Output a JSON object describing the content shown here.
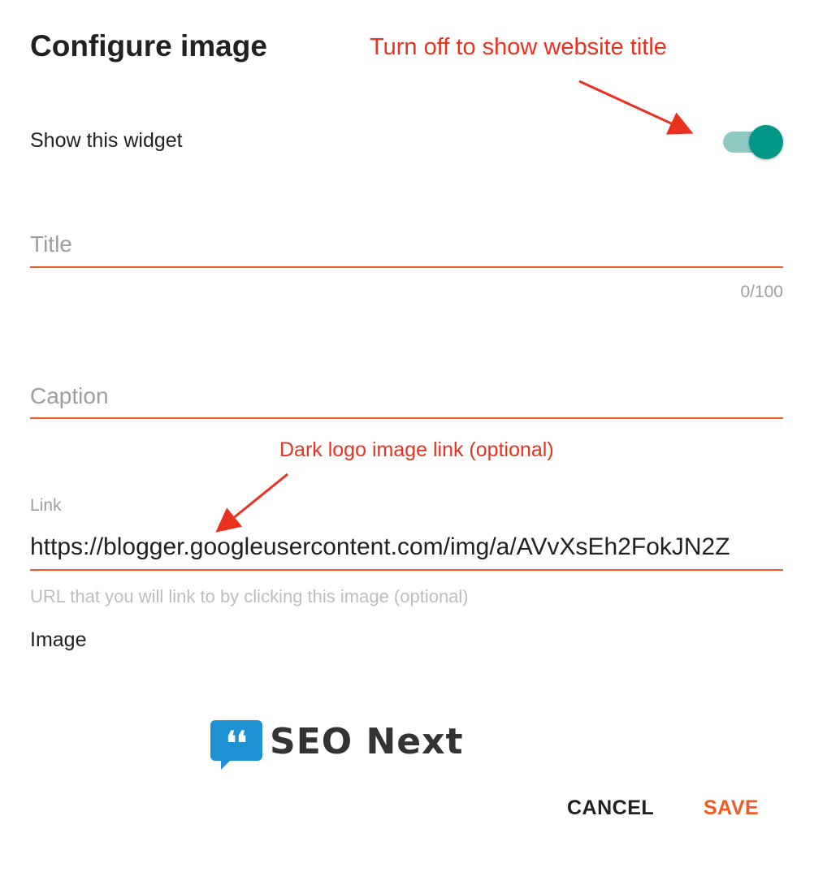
{
  "dialog": {
    "title": "Configure image",
    "show_widget_label": "Show this widget",
    "show_widget_on": true
  },
  "title_field": {
    "placeholder": "Title",
    "counter": "0/100"
  },
  "caption_field": {
    "placeholder": "Caption"
  },
  "link_field": {
    "label": "Link",
    "value": "https://blogger.googleusercontent.com/img/a/AVvXsEh2FokJN2Z",
    "help": "URL that you will link to by clicking this image (optional)"
  },
  "image_section": {
    "label": "Image",
    "logo_text": "SEO Next",
    "logo_glyph": "❛❛"
  },
  "actions": {
    "cancel": "CANCEL",
    "save": "SAVE"
  },
  "annotations": {
    "toggle_note": "Turn off to show website title",
    "link_note": "Dark logo image link (optional)"
  },
  "colors": {
    "accent": "#ef5a24",
    "toggle": "#009688",
    "annotation": "#e8311f",
    "logo_bubble": "#1e90d4"
  }
}
